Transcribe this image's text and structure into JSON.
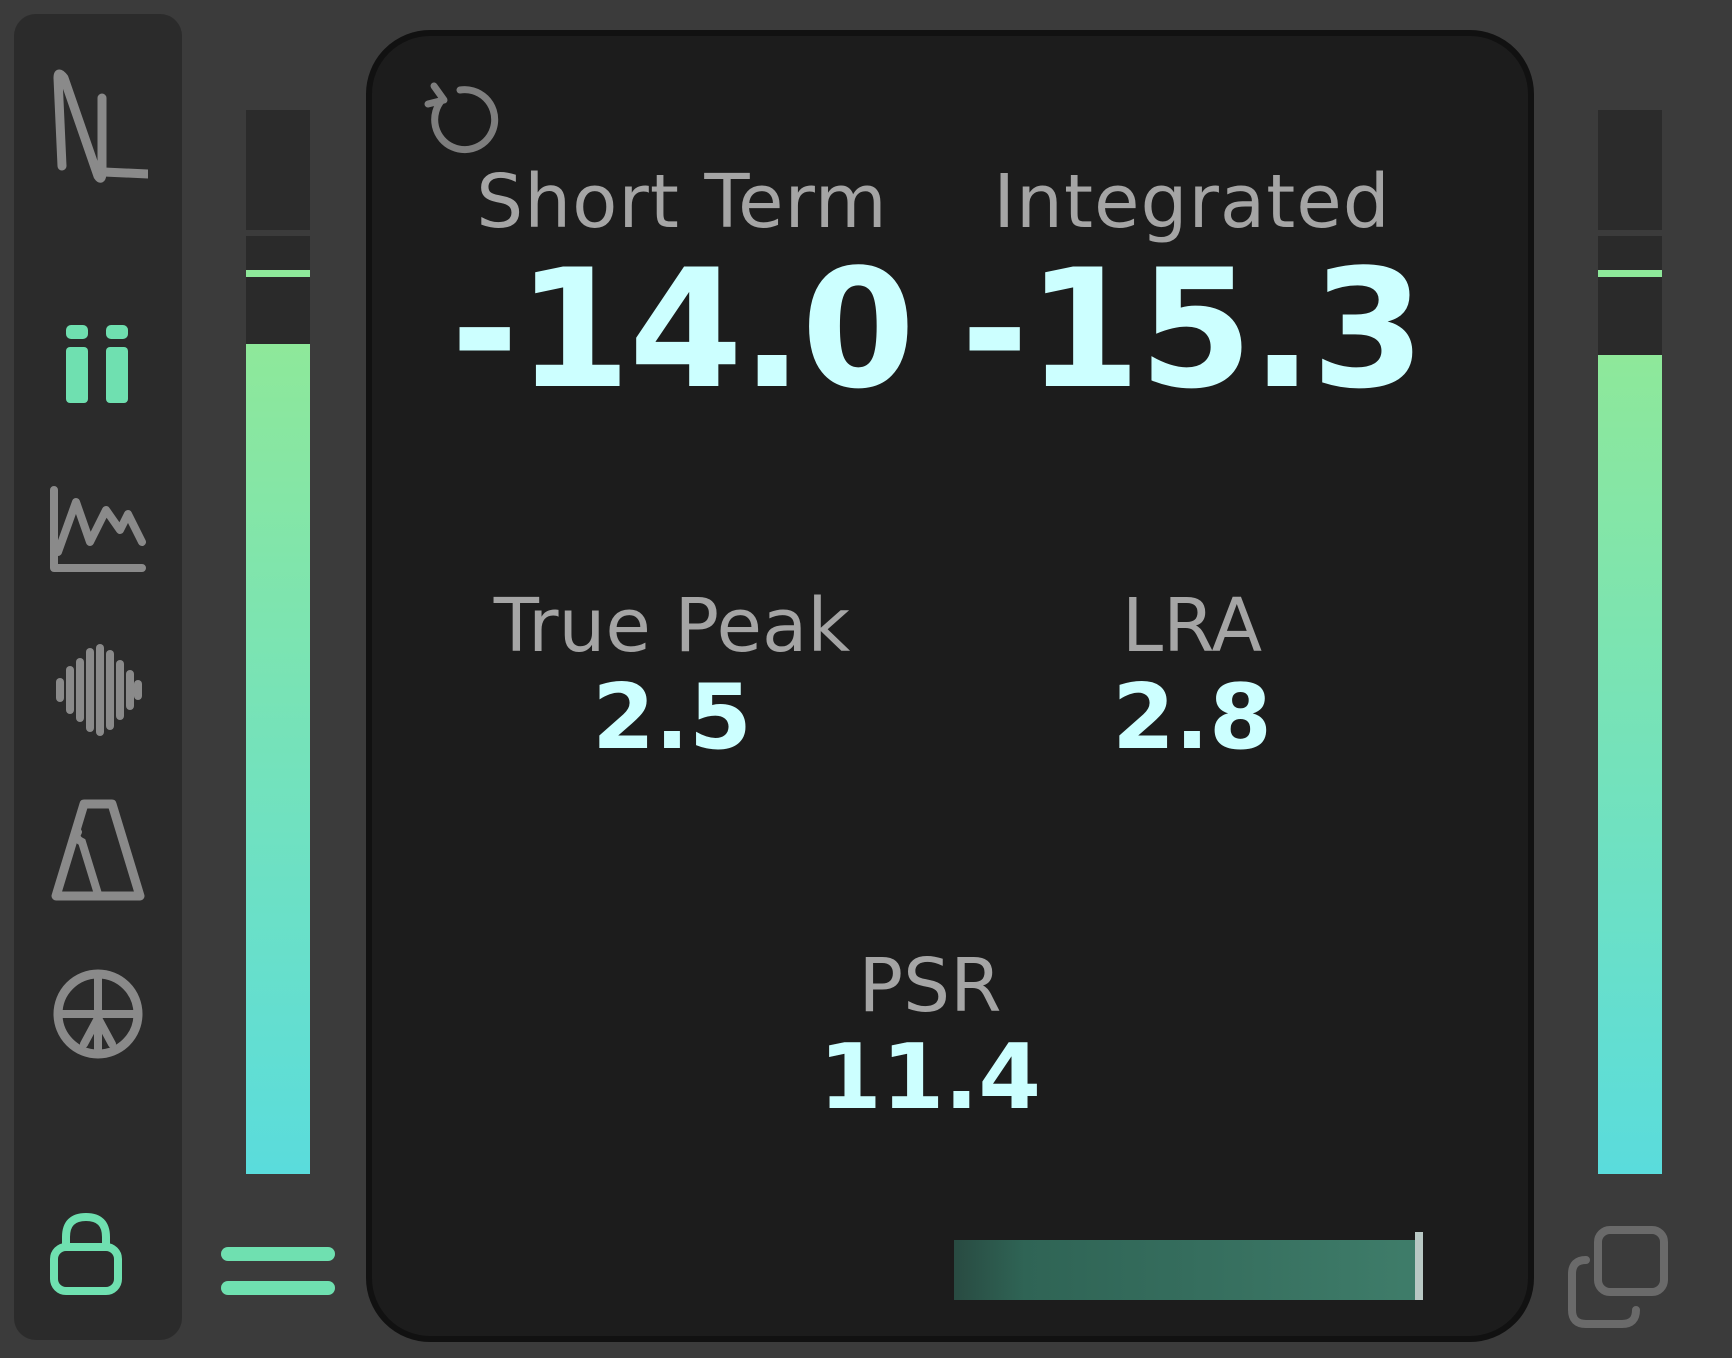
{
  "metrics": {
    "short_term": {
      "label": "Short Term",
      "value": "-14.0"
    },
    "integrated": {
      "label": "Integrated",
      "value": "-15.3"
    },
    "true_peak": {
      "label": "True Peak",
      "value": "2.5"
    },
    "lra": {
      "label": "LRA",
      "value": "2.8"
    },
    "psr": {
      "label": "PSR",
      "value": "11.4"
    }
  },
  "meters": {
    "left_level": 0.78,
    "right_level": 0.77
  },
  "sidebar": {
    "items": [
      {
        "icon": "logo-icon",
        "active": false
      },
      {
        "icon": "meters-icon",
        "active": true
      },
      {
        "icon": "graph-icon",
        "active": false
      },
      {
        "icon": "waveform-icon",
        "active": false
      },
      {
        "icon": "metronome-icon",
        "active": false
      },
      {
        "icon": "vectorscope-icon",
        "active": false
      },
      {
        "icon": "lock-icon",
        "active": true
      }
    ]
  },
  "colors": {
    "background": "#3b3b3b",
    "panel": "#1c1c1c",
    "value_text": "#ccffff",
    "label_text": "#a5a5a5",
    "accent": "#6fe0b0",
    "meter_top": "#8ee89a",
    "meter_bottom": "#5adcdc",
    "icon_gray": "#8a8a8a"
  }
}
